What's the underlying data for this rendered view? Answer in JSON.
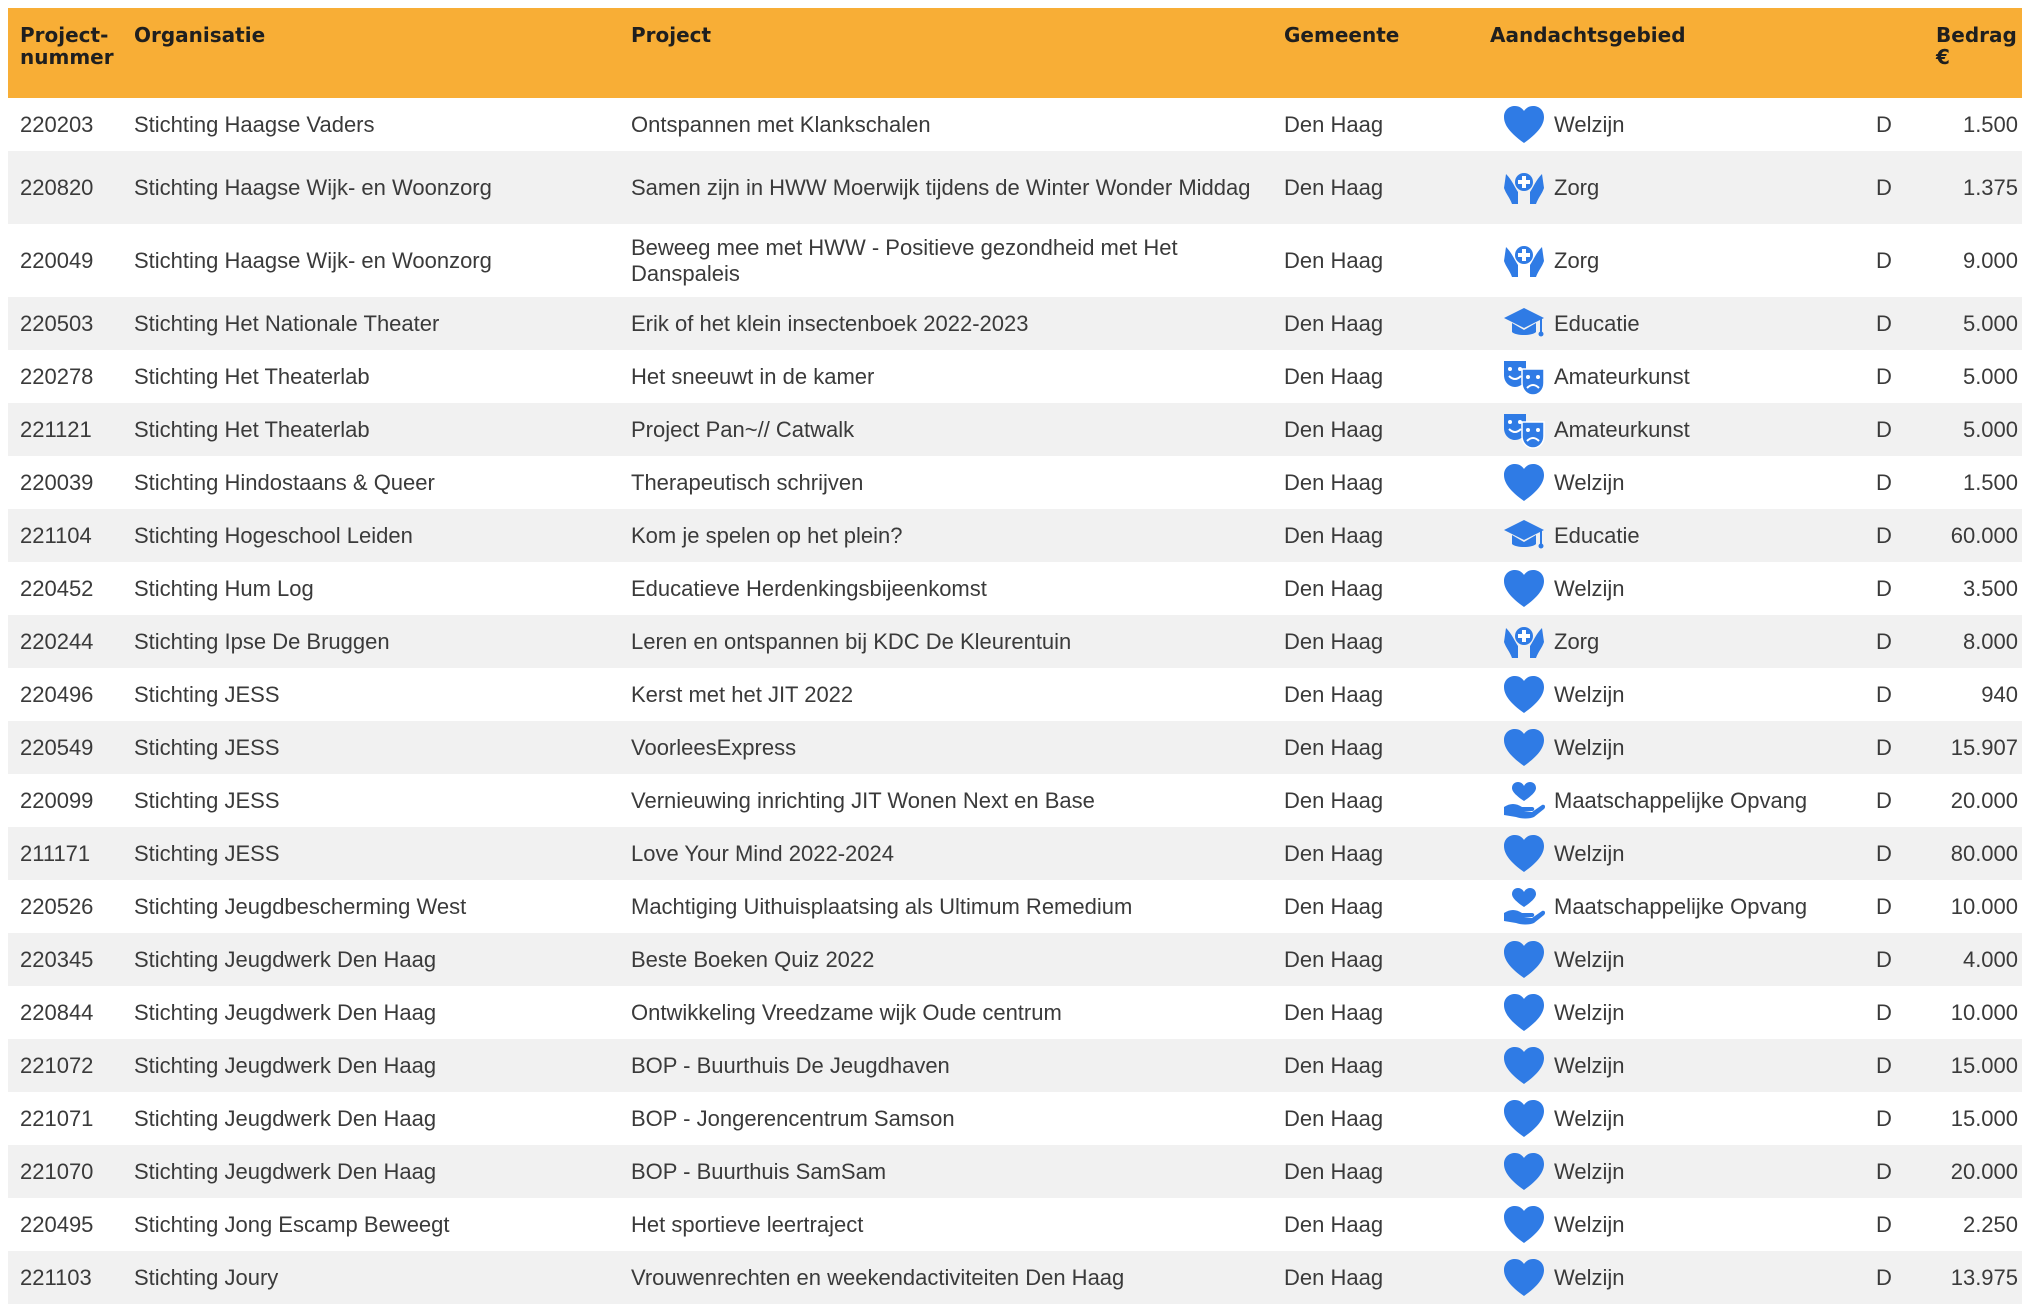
{
  "columns": {
    "nummer": "Project-\nnummer",
    "organisatie": "Organisatie",
    "project": "Project",
    "gemeente": "Gemeente",
    "aandachtsgebied": "Aandachtsgebied",
    "bedrag": "Bedrag\n€"
  },
  "colors": {
    "header_bg": "#f8ae36",
    "icon": "#2f7be5",
    "row_alt": "#f1f1f1"
  },
  "rows": [
    {
      "nummer": "220203",
      "organisatie": "Stichting Haagse Vaders",
      "project": "Ontspannen met Klankschalen",
      "gemeente": "Den Haag",
      "icon": "heart-icon",
      "gebied": "Welzijn",
      "status": "D",
      "bedrag": "1.500"
    },
    {
      "nummer": "220820",
      "organisatie": "Stichting Haagse Wijk- en Woonzorg",
      "project": "Samen zijn in HWW Moerwijk tijdens de Winter Wonder Middag",
      "gemeente": "Den Haag",
      "icon": "care-hands-icon",
      "gebied": "Zorg",
      "status": "D",
      "bedrag": "1.375"
    },
    {
      "nummer": "220049",
      "organisatie": "Stichting Haagse Wijk- en Woonzorg",
      "project": "Beweeg mee met HWW - Positieve gezondheid met Het Danspaleis",
      "gemeente": "Den Haag",
      "icon": "care-hands-icon",
      "gebied": "Zorg",
      "status": "D",
      "bedrag": "9.000"
    },
    {
      "nummer": "220503",
      "organisatie": "Stichting Het Nationale Theater",
      "project": "Erik of het klein insectenboek 2022-2023",
      "gemeente": "Den Haag",
      "icon": "graduation-cap-icon",
      "gebied": "Educatie",
      "status": "D",
      "bedrag": "5.000"
    },
    {
      "nummer": "220278",
      "organisatie": "Stichting Het Theaterlab",
      "project": "Het sneeuwt in de kamer",
      "gemeente": "Den Haag",
      "icon": "theater-masks-icon",
      "gebied": "Amateurkunst",
      "status": "D",
      "bedrag": "5.000"
    },
    {
      "nummer": "221121",
      "organisatie": "Stichting Het Theaterlab",
      "project": "Project Pan~// Catwalk",
      "gemeente": "Den Haag",
      "icon": "theater-masks-icon",
      "gebied": "Amateurkunst",
      "status": "D",
      "bedrag": "5.000"
    },
    {
      "nummer": "220039",
      "organisatie": "Stichting Hindostaans & Queer",
      "project": "Therapeutisch schrijven",
      "gemeente": "Den Haag",
      "icon": "heart-icon",
      "gebied": "Welzijn",
      "status": "D",
      "bedrag": "1.500"
    },
    {
      "nummer": "221104",
      "organisatie": "Stichting Hogeschool Leiden",
      "project": "Kom je spelen op het plein?",
      "gemeente": "Den Haag",
      "icon": "graduation-cap-icon",
      "gebied": "Educatie",
      "status": "D",
      "bedrag": "60.000"
    },
    {
      "nummer": "220452",
      "organisatie": "Stichting Hum Log",
      "project": "Educatieve Herdenkingsbijeenkomst",
      "gemeente": "Den Haag",
      "icon": "heart-icon",
      "gebied": "Welzijn",
      "status": "D",
      "bedrag": "3.500"
    },
    {
      "nummer": "220244",
      "organisatie": "Stichting Ipse De Bruggen",
      "project": "Leren en ontspannen bij KDC De Kleurentuin",
      "gemeente": "Den Haag",
      "icon": "care-hands-icon",
      "gebied": "Zorg",
      "status": "D",
      "bedrag": "8.000"
    },
    {
      "nummer": "220496",
      "organisatie": "Stichting JESS",
      "project": "Kerst met het JIT 2022",
      "gemeente": "Den Haag",
      "icon": "heart-icon",
      "gebied": "Welzijn",
      "status": "D",
      "bedrag": "940"
    },
    {
      "nummer": "220549",
      "organisatie": "Stichting JESS",
      "project": "VoorleesExpress",
      "gemeente": "Den Haag",
      "icon": "heart-icon",
      "gebied": "Welzijn",
      "status": "D",
      "bedrag": "15.907"
    },
    {
      "nummer": "220099",
      "organisatie": "Stichting JESS",
      "project": "Vernieuwing inrichting JIT Wonen Next en Base",
      "gemeente": "Den Haag",
      "icon": "hand-heart-icon",
      "gebied": "Maatschappelijke Opvang",
      "status": "D",
      "bedrag": "20.000"
    },
    {
      "nummer": "211171",
      "organisatie": "Stichting JESS",
      "project": "Love Your Mind 2022-2024",
      "gemeente": "Den Haag",
      "icon": "heart-icon",
      "gebied": "Welzijn",
      "status": "D",
      "bedrag": "80.000"
    },
    {
      "nummer": "220526",
      "organisatie": "Stichting Jeugdbescherming West",
      "project": "Machtiging Uithuisplaatsing als Ultimum Remedium",
      "gemeente": "Den Haag",
      "icon": "hand-heart-icon",
      "gebied": "Maatschappelijke Opvang",
      "status": "D",
      "bedrag": "10.000"
    },
    {
      "nummer": "220345",
      "organisatie": "Stichting Jeugdwerk Den Haag",
      "project": "Beste Boeken Quiz 2022",
      "gemeente": "Den Haag",
      "icon": "heart-icon",
      "gebied": "Welzijn",
      "status": "D",
      "bedrag": "4.000"
    },
    {
      "nummer": "220844",
      "organisatie": "Stichting Jeugdwerk Den Haag",
      "project": "Ontwikkeling Vreedzame wijk Oude centrum",
      "gemeente": "Den Haag",
      "icon": "heart-icon",
      "gebied": "Welzijn",
      "status": "D",
      "bedrag": "10.000"
    },
    {
      "nummer": "221072",
      "organisatie": "Stichting Jeugdwerk Den Haag",
      "project": "BOP - Buurthuis De Jeugdhaven",
      "gemeente": "Den Haag",
      "icon": "heart-icon",
      "gebied": "Welzijn",
      "status": "D",
      "bedrag": "15.000"
    },
    {
      "nummer": "221071",
      "organisatie": "Stichting Jeugdwerk Den Haag",
      "project": "BOP - Jongerencentrum Samson",
      "gemeente": "Den Haag",
      "icon": "heart-icon",
      "gebied": "Welzijn",
      "status": "D",
      "bedrag": "15.000"
    },
    {
      "nummer": "221070",
      "organisatie": "Stichting Jeugdwerk Den Haag",
      "project": "BOP - Buurthuis SamSam",
      "gemeente": "Den Haag",
      "icon": "heart-icon",
      "gebied": "Welzijn",
      "status": "D",
      "bedrag": "20.000"
    },
    {
      "nummer": "220495",
      "organisatie": "Stichting Jong Escamp Beweegt",
      "project": "Het sportieve leertraject",
      "gemeente": "Den Haag",
      "icon": "heart-icon",
      "gebied": "Welzijn",
      "status": "D",
      "bedrag": "2.250"
    },
    {
      "nummer": "221103",
      "organisatie": "Stichting Joury",
      "project": "Vrouwenrechten en weekendactiviteiten Den Haag",
      "gemeente": "Den Haag",
      "icon": "heart-icon",
      "gebied": "Welzijn",
      "status": "D",
      "bedrag": "13.975"
    }
  ]
}
